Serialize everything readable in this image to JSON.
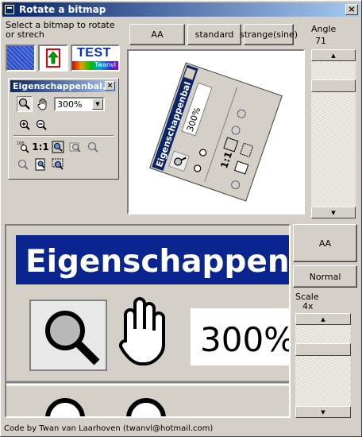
{
  "window": {
    "title": "Rotate a bitmap",
    "close_glyph": "×"
  },
  "left_panel": {
    "instruction": "Select a bitmap to rotate or strech",
    "thumbnails": [
      {
        "name": "noise",
        "icon": "noise-texture-icon"
      },
      {
        "name": "arrow",
        "icon": "green-up-arrow-icon"
      },
      {
        "name": "test",
        "text": "TEST",
        "sub": "Twanvl"
      }
    ]
  },
  "toolbar_window": {
    "title": "Eigenschappenbal...",
    "close_glyph": "×",
    "zoom_value": "300%",
    "one_to_one": "1:1",
    "icons": [
      "magnifier-icon",
      "hand-icon",
      "zoom-in-icon",
      "zoom-out-icon",
      "zoom-100-icon",
      "fit-icon",
      "zoom-fit-width-icon",
      "zoom-fit-height-icon",
      "zoom-prev-icon",
      "zoom-page-icon",
      "zoom-selection-icon"
    ]
  },
  "mode_buttons": [
    "AA",
    "standard",
    "strange(sine)"
  ],
  "angle": {
    "label": "Angle",
    "value": "71",
    "scroll_position": 0.14
  },
  "zoom_controls": {
    "aa_label": "AA",
    "normal_label": "Normal"
  },
  "scale": {
    "label": "Scale",
    "value": "4x",
    "scroll_position": 0.27
  },
  "preview": {
    "title_text": "Eigenschappenbal",
    "zoom_text": "300%"
  },
  "status": "Code by Twan van Laarhoven (twanvl@hotmail.com)",
  "colors": {
    "titlebar": "#0a246a",
    "face": "#d4d0c8"
  }
}
